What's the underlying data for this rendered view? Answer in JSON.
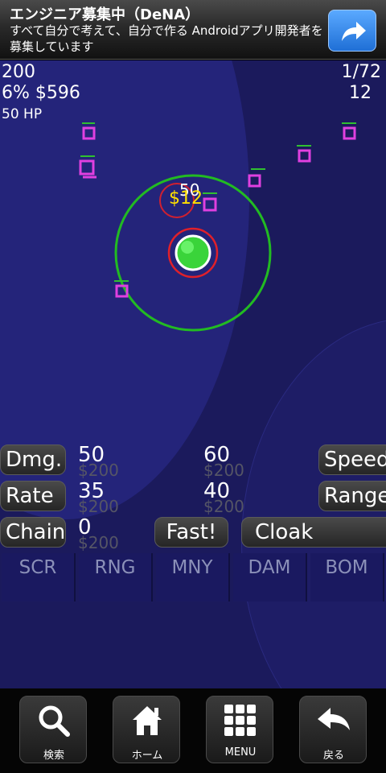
{
  "ad": {
    "title": "エンジニア募集中（DeNA）",
    "text": "すべて自分で考えて、自分で作る Androidアプリ開発者を募集しています"
  },
  "stats": {
    "score": "200",
    "percent_money": "6% $596",
    "hp": "50 HP",
    "wave": "1/72",
    "enemies_left": "12"
  },
  "floating": {
    "reward": "$12",
    "damage": "50"
  },
  "upgrades": {
    "dmg_label": "Dmg.",
    "dmg_value": "50",
    "dmg_cost": "$200",
    "dmg_next": "60",
    "dmg_next_cost": "$200",
    "speed_label": "Speed",
    "rate_label": "Rate",
    "rate_value": "35",
    "rate_cost": "$200",
    "rate_next": "40",
    "rate_next_cost": "$200",
    "range_label": "Range",
    "chain_label": "Chain",
    "chain_value": "0",
    "chain_cost": "$200",
    "fast_label": "Fast!",
    "cloak_label": "Cloak"
  },
  "tabs": [
    "SCR",
    "RNG",
    "MNY",
    "DAM",
    "BOM"
  ],
  "nav": {
    "search": "検索",
    "home": "ホーム",
    "menu": "MENU",
    "back": "戻る"
  },
  "colors": {
    "enemy": "#e040e0",
    "health_bar": "#30c030",
    "range_ring": "#22bb22",
    "tower": "#3ad43a",
    "tower_ring": "#e0202a",
    "reward_text": "#ffe000",
    "background": "#1b1a5c"
  },
  "icons": {
    "ad": "share-arrow-icon",
    "search": "magnifier-icon",
    "home": "house-icon",
    "menu": "grid-icon",
    "back": "back-arrow-icon"
  }
}
